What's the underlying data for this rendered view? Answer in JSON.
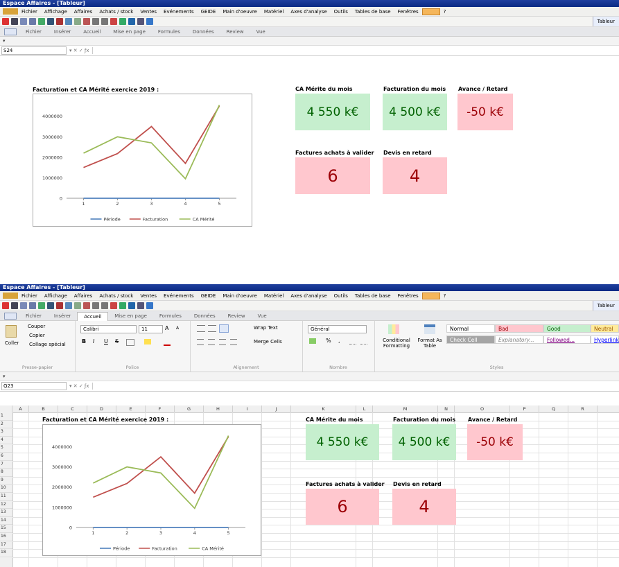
{
  "app": {
    "title": "Espace Affaires - [Tableur]",
    "menu": [
      "Fichier",
      "Affichage",
      "Affaires",
      "Achats / stock",
      "Ventes",
      "Evénements",
      "GEIDE",
      "Main d'oeuvre",
      "Matériel",
      "Axes d'analyse",
      "Outils",
      "Tables de base",
      "Fenêtres",
      "?"
    ],
    "tab_label": "Tableur",
    "ribbon_tabs": [
      "Fichier",
      "Insérer",
      "Accueil",
      "Mise en page",
      "Formules",
      "Données",
      "Review",
      "Vue"
    ]
  },
  "window1": {
    "active_tab": "",
    "cell_ref": "S24",
    "qat": "▾"
  },
  "window2": {
    "active_tab": "Accueil",
    "cell_ref": "Q23",
    "qat": "▾"
  },
  "ribbon": {
    "clipboard": {
      "paste": "Coller",
      "cut": "Couper",
      "copy": "Copier",
      "special": "Collage spécial",
      "label": "Presse-papier"
    },
    "font": {
      "name": "Calibri",
      "size": "11",
      "grow": "A",
      "shrink": "A",
      "bold": "B",
      "italic": "I",
      "underline": "U",
      "strike": "S",
      "label": "Police"
    },
    "alignment": {
      "wrap": "Wrap Text",
      "merge": "Merge Cells",
      "label": "Alignement"
    },
    "number": {
      "format": "Général",
      "pct": "%",
      "comma": ",",
      "label": "Nombre"
    },
    "styles_group": {
      "cond": "Conditional Formatting",
      "table": "Format As Table",
      "label": "Styles"
    },
    "styles": [
      {
        "label": "Normal",
        "bg": "#ffffff",
        "fg": "#000000"
      },
      {
        "label": "Bad",
        "bg": "#ffc7ce",
        "fg": "#9c0006"
      },
      {
        "label": "Good",
        "bg": "#c6efce",
        "fg": "#006100"
      },
      {
        "label": "Neutral",
        "bg": "#ffeb9c",
        "fg": "#9c5700"
      },
      {
        "label": "Check Cell",
        "bg": "#a5a5a5",
        "fg": "#ffffff"
      },
      {
        "label": "Explanatory...",
        "bg": "#ffffff",
        "fg": "#7f7f7f"
      },
      {
        "label": "Followed...",
        "bg": "#ffffff",
        "fg": "#800080"
      },
      {
        "label": "Hyperlink",
        "bg": "#ffffff",
        "fg": "#0000ff"
      }
    ]
  },
  "dashboard": {
    "chart_title": "Facturation et CA Mérité exercice 2019 :",
    "kpis": [
      {
        "label": "CA Mérite du mois",
        "value": "4 550 k€",
        "status": "green"
      },
      {
        "label": "Facturation du mois",
        "value": "4 500 k€",
        "status": "green"
      },
      {
        "label": "Avance / Retard",
        "value": "-50 k€",
        "status": "red"
      },
      {
        "label": "Factures achats à valider",
        "value": "6",
        "status": "red"
      },
      {
        "label": "Devis en retard",
        "value": "4",
        "status": "red"
      }
    ]
  },
  "sheet": {
    "columns": [
      "A",
      "B",
      "C",
      "D",
      "E",
      "F",
      "G",
      "H",
      "I",
      "J",
      "K",
      "L",
      "M",
      "N",
      "O",
      "P",
      "Q",
      "R"
    ],
    "rows": [
      "1",
      "2",
      "3",
      "4",
      "5",
      "6",
      "7",
      "8",
      "9",
      "10",
      "11",
      "12",
      "13",
      "14",
      "15",
      "16",
      "17",
      "18"
    ]
  },
  "chart_data": {
    "type": "line",
    "categories": [
      "1",
      "2",
      "3",
      "4",
      "5"
    ],
    "yticks": [
      "0",
      "1000000",
      "2000000",
      "3000000",
      "4000000"
    ],
    "ylim": [
      0,
      4600000
    ],
    "legend_position": "bottom",
    "grid": false,
    "series": [
      {
        "name": "Période",
        "values": [
          0,
          0,
          0,
          0,
          0
        ],
        "color": "#4f81bd"
      },
      {
        "name": "Facturation",
        "values": [
          1500000,
          2180000,
          3500000,
          1700000,
          4500000
        ],
        "color": "#c0504d"
      },
      {
        "name": "CA Mérité",
        "values": [
          2200000,
          3000000,
          2700000,
          950000,
          4550000
        ],
        "color": "#9bbb59"
      }
    ]
  }
}
